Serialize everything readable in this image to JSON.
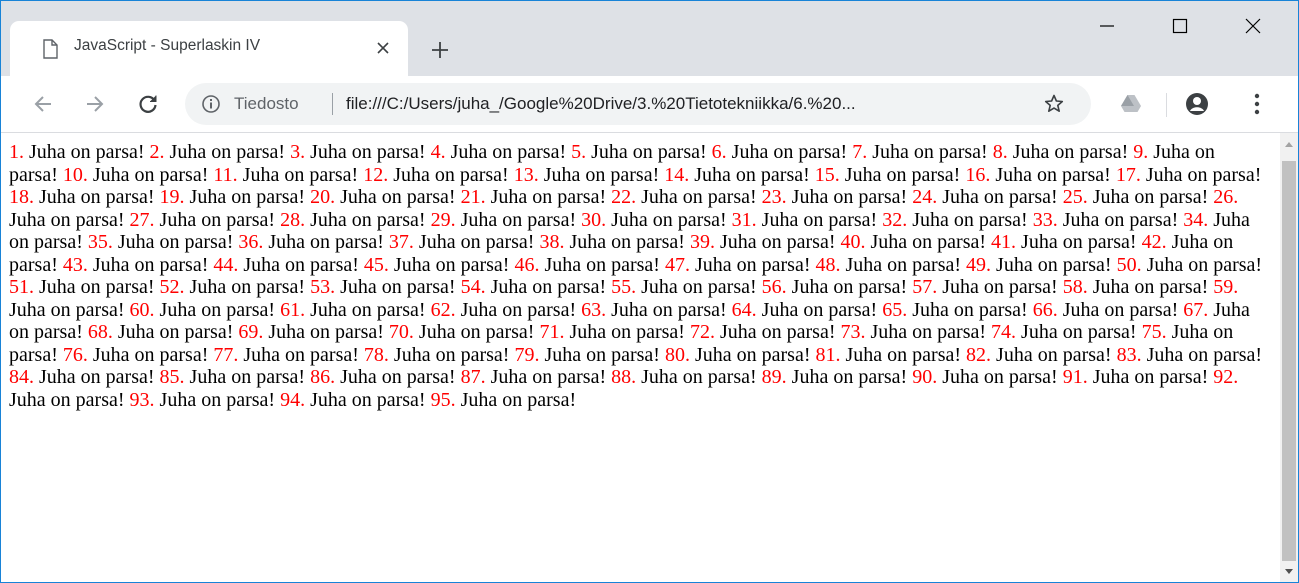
{
  "tab": {
    "title": "JavaScript - Superlaskin IV",
    "icon": "document-icon"
  },
  "window_controls": {
    "minimize_icon": "minimize-icon",
    "maximize_icon": "maximize-icon",
    "close_icon": "close-icon"
  },
  "toolbar": {
    "security_label": "Tiedosto",
    "url": "file:///C:/Users/juha_/Google%20Drive/3.%20Tietotekniikka/6.%20..."
  },
  "content": {
    "phrase": "Juha on parsa!",
    "count": 95,
    "items": [
      "1.",
      "2.",
      "3.",
      "4.",
      "5.",
      "6.",
      "7.",
      "8.",
      "9.",
      "10.",
      "11.",
      "12.",
      "13.",
      "14.",
      "15.",
      "16.",
      "17.",
      "18.",
      "19.",
      "20.",
      "21.",
      "22.",
      "23.",
      "24.",
      "25.",
      "26.",
      "27.",
      "28.",
      "29.",
      "30.",
      "31.",
      "32.",
      "33.",
      "34.",
      "35.",
      "36.",
      "37.",
      "38.",
      "39.",
      "40.",
      "41.",
      "42.",
      "43.",
      "44.",
      "45.",
      "46.",
      "47.",
      "48.",
      "49.",
      "50.",
      "51.",
      "52.",
      "53.",
      "54.",
      "55.",
      "56.",
      "57.",
      "58.",
      "59.",
      "60.",
      "61.",
      "62.",
      "63.",
      "64.",
      "65.",
      "66.",
      "67.",
      "68.",
      "69.",
      "70.",
      "71.",
      "72.",
      "73.",
      "74.",
      "75.",
      "76.",
      "77.",
      "78.",
      "79.",
      "80.",
      "81.",
      "82.",
      "83.",
      "84.",
      "85.",
      "86.",
      "87.",
      "88.",
      "89.",
      "90.",
      "91.",
      "92.",
      "93.",
      "94.",
      "95."
    ]
  },
  "colors": {
    "number": "#ff0000",
    "text": "#000000",
    "tabstrip": "#dee1e6",
    "omnibox": "#f1f3f4",
    "window_border": "#1883d7"
  }
}
